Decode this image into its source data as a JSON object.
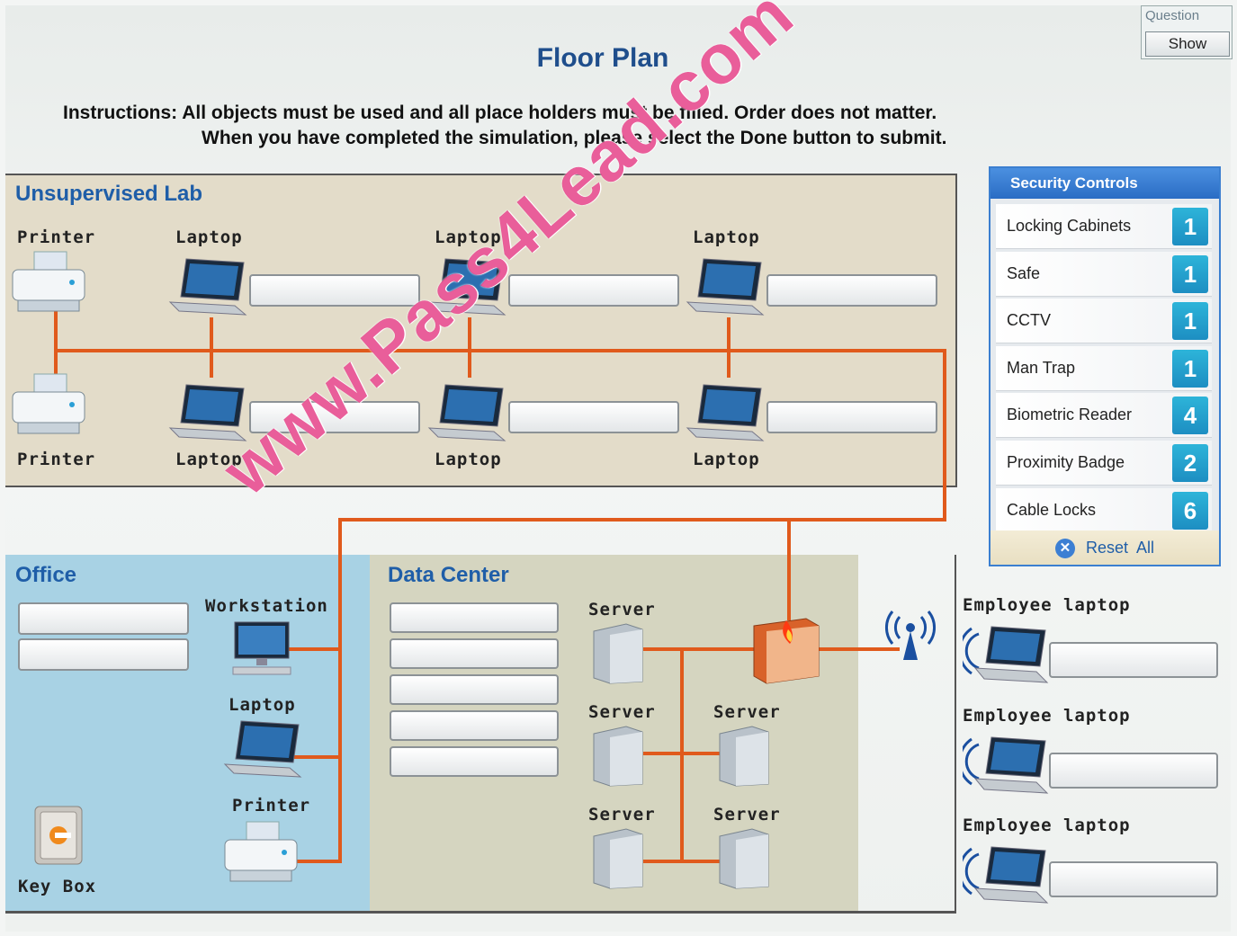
{
  "page": {
    "title": "Floor Plan",
    "instructions": {
      "line1": "Instructions: All objects must be used and all place holders must be filled. Order does not matter.",
      "line2": "When you have completed the simulation, please select the Done button to submit."
    },
    "watermark": "www.Pass4Lead.com"
  },
  "question": {
    "label": "Question",
    "show_button": "Show"
  },
  "rooms": {
    "lab": {
      "title": "Unsupervised Lab",
      "printer_top": "Printer",
      "printer_bottom": "Printer",
      "laptops_top": [
        "Laptop",
        "Laptop",
        "Laptop"
      ],
      "laptops_bottom": [
        "Laptop",
        "Laptop",
        "Laptop"
      ]
    },
    "office": {
      "title": "Office",
      "workstation": "Workstation",
      "laptop": "Laptop",
      "printer": "Printer",
      "key_box": "Key Box"
    },
    "data_center": {
      "title": "Data Center",
      "servers": [
        "Server",
        "Server",
        "Server",
        "Server",
        "Server"
      ]
    }
  },
  "employee_laptops": [
    "Employee laptop",
    "Employee laptop",
    "Employee laptop"
  ],
  "security_controls": {
    "title": "Security Controls",
    "items": [
      {
        "name": "Locking Cabinets",
        "count": "1"
      },
      {
        "name": "Safe",
        "count": "1"
      },
      {
        "name": "CCTV",
        "count": "1"
      },
      {
        "name": "Man Trap",
        "count": "1"
      },
      {
        "name": "Biometric Reader",
        "count": "4"
      },
      {
        "name": "Proximity Badge",
        "count": "2"
      },
      {
        "name": "Cable Locks",
        "count": "6"
      }
    ],
    "reset_label": "Reset  All"
  },
  "colors": {
    "title_blue": "#1f4e8c",
    "room_title_blue": "#1f5ea8",
    "network_line": "#e05a1c",
    "count_badge": "#1d8ec2",
    "lab_bg": "#e3dcc9",
    "office_bg": "#a8d2e4",
    "datacenter_bg": "#d5d5c0"
  },
  "icons": [
    "printer-icon",
    "laptop-icon",
    "workstation-icon",
    "server-icon",
    "firewall-icon",
    "wireless-ap-icon",
    "key-box-icon",
    "wireless-laptop-icon",
    "reset-icon"
  ]
}
